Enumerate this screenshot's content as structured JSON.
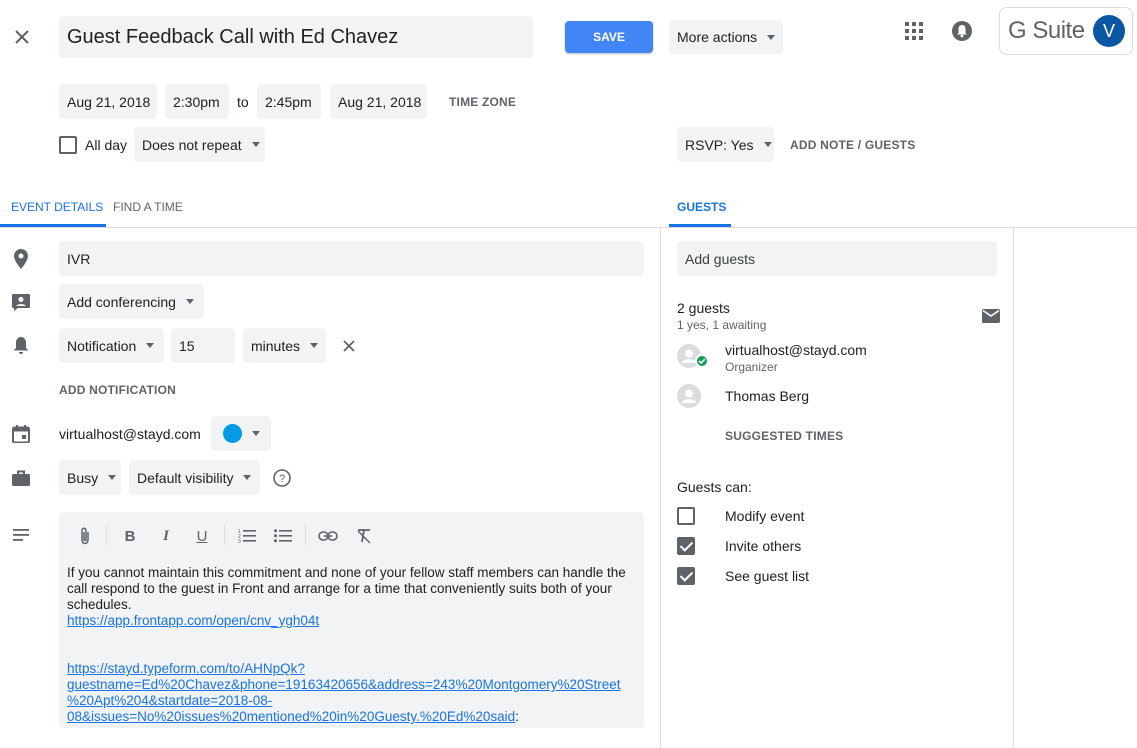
{
  "header": {
    "title": "Guest Feedback Call with Ed Chavez",
    "save_label": "SAVE",
    "more_actions_label": "More actions",
    "gsuite_label": "G Suite",
    "avatar_initial": "V"
  },
  "datetime": {
    "start_date": "Aug 21, 2018",
    "start_time": "2:30pm",
    "to_label": "to",
    "end_time": "2:45pm",
    "end_date": "Aug 21, 2018",
    "time_zone_label": "TIME ZONE",
    "all_day_label": "All day",
    "repeat_value": "Does not repeat",
    "rsvp_value": "RSVP: Yes",
    "add_note_label": "ADD NOTE / GUESTS"
  },
  "tabs": {
    "event_details": "EVENT DETAILS",
    "find_a_time": "FIND A TIME",
    "guests": "GUESTS"
  },
  "details": {
    "location": "IVR",
    "conferencing": "Add conferencing",
    "notification_type": "Notification",
    "notification_value": "15",
    "notification_unit": "minutes",
    "add_notification_label": "ADD NOTIFICATION",
    "calendar_owner": "virtualhost@stayd.com",
    "calendar_color": "#039be5",
    "availability": "Busy",
    "visibility": "Default visibility",
    "description_text": "If you cannot maintain this commitment and none of your fellow staff members can handle the call respond to the guest in Front and arrange for a time that conveniently suits both of your schedules.",
    "link1": "https://app.frontapp.com/open/cnv_ygh04t",
    "link2_line1": "https://stayd.typeform.com/to/AHNpQk?",
    "link2_line2": "guestname=Ed%20Chavez&phone=19163420656&address=243%20Montgomery%20Street",
    "link2_line3": "%20Apt%204&startdate=2018-08-",
    "link2_line4": "08&issues=No%20issues%20mentioned%20in%20Guesty.%20Ed%20said",
    "link2_suffix": ":"
  },
  "guests": {
    "add_placeholder": "Add guests",
    "count": "2 guests",
    "summary": "1 yes, 1 awaiting",
    "list": [
      {
        "name": "virtualhost@stayd.com",
        "role": "Organizer"
      },
      {
        "name": "Thomas Berg",
        "role": ""
      }
    ],
    "suggested_times_label": "SUGGESTED TIMES",
    "guests_can_label": "Guests can:",
    "permissions": [
      {
        "label": "Modify event",
        "checked": false
      },
      {
        "label": "Invite others",
        "checked": true
      },
      {
        "label": "See guest list",
        "checked": true
      }
    ]
  },
  "colors": {
    "accent": "#1a73e8",
    "save_button": "#4285f4",
    "avatar_bg": "#0b57a4",
    "accepted_badge": "#0f9d58"
  }
}
